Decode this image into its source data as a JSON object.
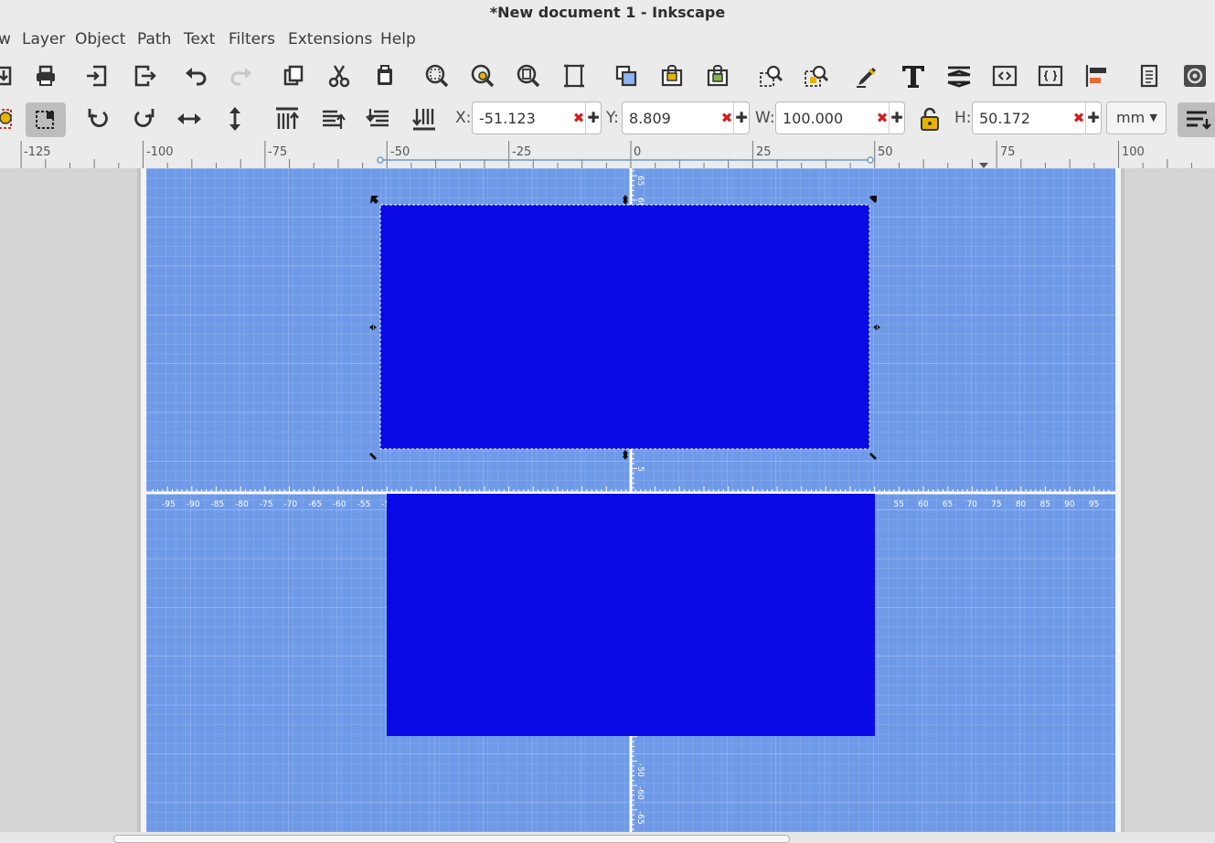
{
  "window": {
    "title": "*New document 1 - Inkscape"
  },
  "menubar": {
    "items": [
      {
        "id": "view",
        "label": "w"
      },
      {
        "id": "layer",
        "label": "Layer"
      },
      {
        "id": "object",
        "label": "Object"
      },
      {
        "id": "path",
        "label": "Path"
      },
      {
        "id": "text",
        "label": "Text"
      },
      {
        "id": "filters",
        "label": "Filters"
      },
      {
        "id": "extensions",
        "label": "Extensions"
      },
      {
        "id": "help",
        "label": "Help"
      }
    ]
  },
  "commands_bar": {
    "icons": [
      "import-icon",
      "print-icon",
      "import-file-icon",
      "export-icon",
      "undo-icon",
      "redo-icon",
      "duplicate-icon",
      "cut-icon",
      "paste-icon",
      "zoom-selection-icon",
      "zoom-drawing-icon",
      "zoom-page-icon",
      "zoom-width-icon",
      "group-icon",
      "ungroup-icon",
      "ungroup-lock-icon",
      "fill-stroke-icon",
      "zoom-objects-icon",
      "xml-editor-icon-a",
      "text-icon",
      "layers-icon",
      "xml-editor-icon",
      "css-editor-icon",
      "align-icon",
      "document-properties-icon",
      "preferences-icon"
    ]
  },
  "tool_controls": {
    "x": {
      "label": "X:",
      "value": "-51.123"
    },
    "y": {
      "label": "Y:",
      "value": "8.809"
    },
    "w": {
      "label": "W:",
      "value": "100.000"
    },
    "h": {
      "label": "H:",
      "value": "50.172"
    },
    "unit": "mm",
    "clear_symbol": "✖",
    "increment_symbol": "✚",
    "lock_state": "unlocked"
  },
  "ruler": {
    "labels": [
      "-125",
      "-100",
      "-75",
      "-50",
      "-25",
      "0",
      "25",
      "50",
      "75",
      "100"
    ]
  },
  "canvas": {
    "colors": {
      "page": "#6f9ae8",
      "rect": "#0a0ae6",
      "grid": "#ffffff",
      "desk": "#d4d4d4"
    },
    "axis_labels_h": [
      "-95",
      "-90",
      "-85",
      "-80",
      "-75",
      "-70",
      "-65",
      "-60",
      "-55",
      "-5",
      "0",
      "55",
      "60",
      "65",
      "70",
      "75",
      "80",
      "85",
      "90",
      "95"
    ],
    "axis_labels_v": [
      "65",
      "60",
      "5",
      "-5",
      "-50",
      "-60",
      "-65"
    ]
  }
}
